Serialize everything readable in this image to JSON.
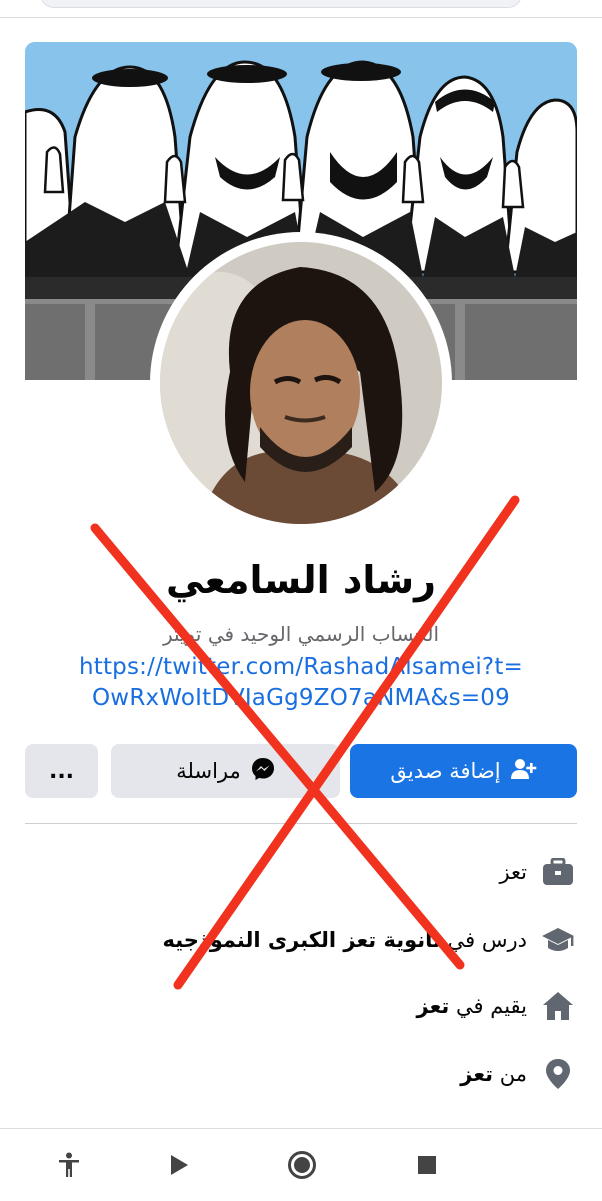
{
  "profile": {
    "name": "رشاد السامعي",
    "bio": "الحساب الرسمي الوحيد في تويتر",
    "link_line1": "https://twitter.com/RashadAlsamei?t=",
    "link_line2": "OwRxWoItDVJaGg9ZO7aNMA&s=09"
  },
  "actions": {
    "add_friend": "إضافة صديق",
    "message": "مراسلة",
    "more": "..."
  },
  "details": {
    "work": "تعز",
    "edu_prefix": "درس في",
    "edu_place": "ثانوية تعز الكبرى النموذجيه",
    "lives_prefix": "يقيم في",
    "lives_place": "تعز",
    "from_prefix": "من",
    "from_place": "تعز"
  },
  "icons": {
    "add_friend": "person-plus-icon",
    "message": "messenger-icon",
    "work": "briefcase-icon",
    "education": "graduation-cap-icon",
    "lives": "home-icon",
    "from": "location-pin-icon",
    "nav": [
      "accessibility-icon",
      "play-icon",
      "home-circle-icon",
      "stop-icon"
    ]
  },
  "colors": {
    "primary": "#1b74e4",
    "link": "#1a6fe0",
    "cross_overlay": "#f0321e",
    "cover_sky": "#87c3ea"
  }
}
